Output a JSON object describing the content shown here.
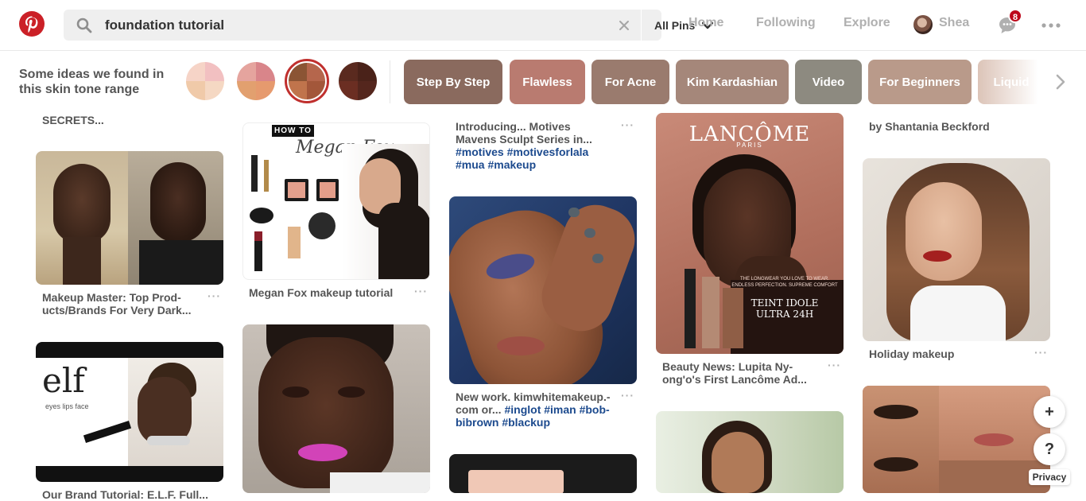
{
  "search": {
    "value": "foundation tutorial",
    "scope_label": "All Pins"
  },
  "nav": {
    "home": "Home",
    "following": "Following",
    "explore": "Explore",
    "user_name": "Shea",
    "notification_count": "8"
  },
  "tones": {
    "label": "Some ideas we found in this skin tone range"
  },
  "chips": [
    "Step By Step",
    "Flawless",
    "For Acne",
    "Kim Kardashian",
    "Video",
    "For Beginners",
    "Liquid"
  ],
  "colors": {
    "brand": "#cb2027",
    "badge": "#bd081c",
    "hashtag": "#1c4a8e"
  },
  "pins": {
    "col1": {
      "top_text": "SECRETS...",
      "p1_title": "Makeup Master: Top Prod-ucts/Brands For Very Dark...",
      "p2_title": "Our Brand Tutorial: E.L.F. Full...",
      "elf_logo": "elf",
      "elf_sub": "eyes lips face"
    },
    "col2": {
      "p1_title": "Megan Fox makeup tutorial",
      "howto": "HOW TO",
      "script": "Megan Fox"
    },
    "col3": {
      "p1_title_a": "Introducing... Motives Mavens Sculpt Series in...",
      "p1_title_b": "#motives #motivesforlala #mua #makeup",
      "p2_title_a": "New work. kimwhitemakeup.-com or...",
      "p2_title_b": "#inglot #iman #bob-bibrown #blackup"
    },
    "col4": {
      "lancome": "LANCÔME",
      "paris": "PARIS",
      "ad_line": "THE LONGWEAR YOU LOVE TO WEAR.",
      "ad_line2": "ENDLESS PERFECTION. SUPREME COMFORT",
      "product": "TEINT IDOLE",
      "product2": "ULTRA 24H",
      "p1_title": "Beauty News: Lupita Ny-ong'o's First Lancôme Ad..."
    },
    "col5": {
      "top_text": "by Shantania Beckford",
      "p1_title": "Holiday makeup"
    }
  },
  "fab": {
    "add": "+",
    "help": "?",
    "privacy": "Privacy"
  }
}
